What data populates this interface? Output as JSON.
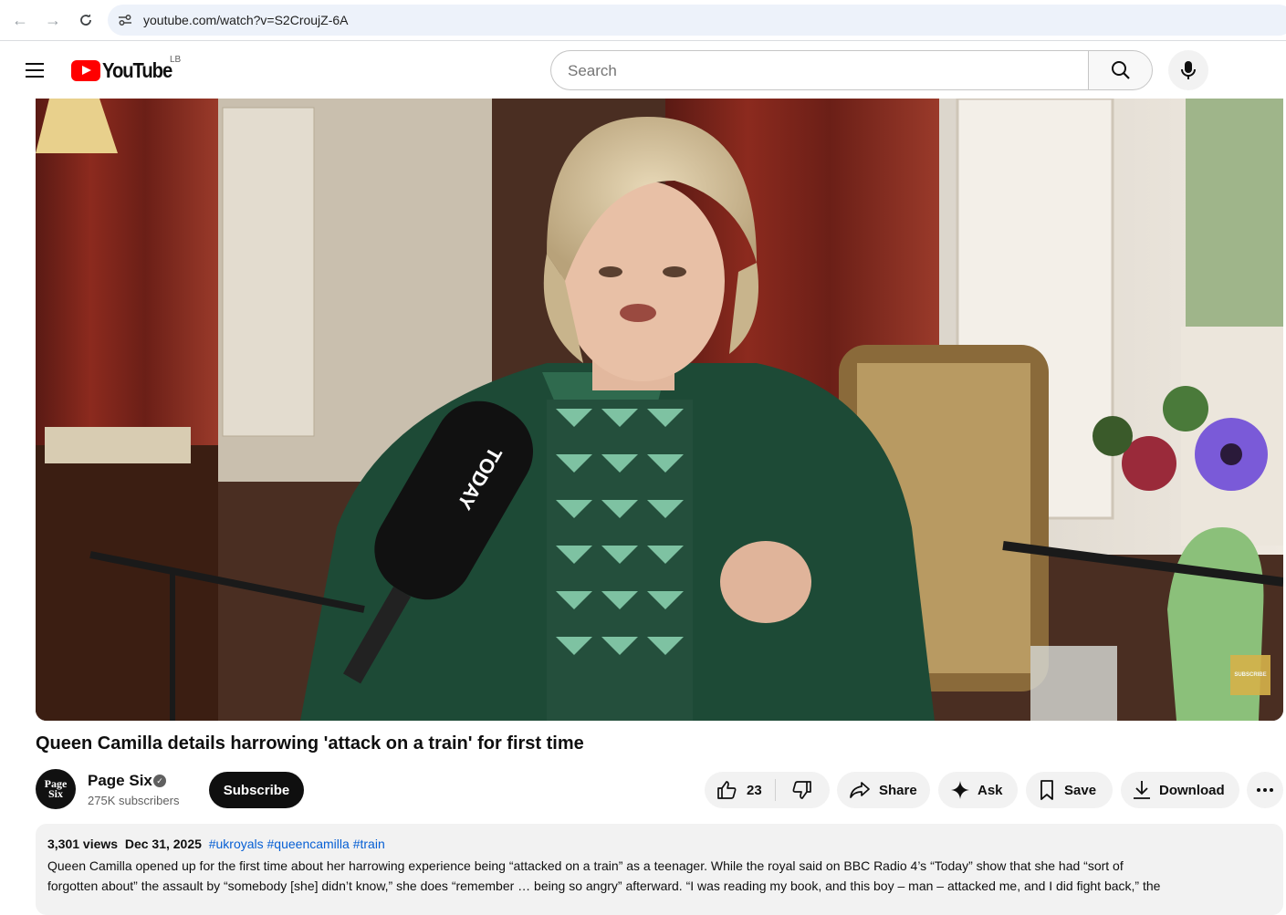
{
  "browser": {
    "url": "youtube.com/watch?v=S2CroujZ-6A"
  },
  "header": {
    "logo_text": "YouTube",
    "country_code": "LB",
    "search_placeholder": "Search"
  },
  "video": {
    "mic_flag_text": "TODAY",
    "watermark_text": "SUBSCRIBE"
  },
  "title": "Queen Camilla details harrowing 'attack on a train' for first time",
  "channel": {
    "avatar_line1": "Page",
    "avatar_line2": "Six",
    "name": "Page Six",
    "subscribers": "275K subscribers",
    "subscribe_label": "Subscribe"
  },
  "actions": {
    "like_count": "23",
    "share_label": "Share",
    "ask_label": "Ask",
    "save_label": "Save",
    "download_label": "Download"
  },
  "description": {
    "views": "3,301 views",
    "date": "Dec 31, 2025",
    "tags": [
      "#ukroyals",
      "#queencamilla",
      "#train"
    ],
    "line1": "Queen Camilla opened up for the first time about her harrowing experience being “attacked on a train” as a teenager. While the royal said on BBC Radio 4’s “Today” show that she had “sort of",
    "line2": "forgotten about” the assault by “somebody [she] didn’t know,” she does “remember … being so angry” afterward. “I was reading my book, and this boy – man – attacked me, and I did fight back,” the"
  }
}
